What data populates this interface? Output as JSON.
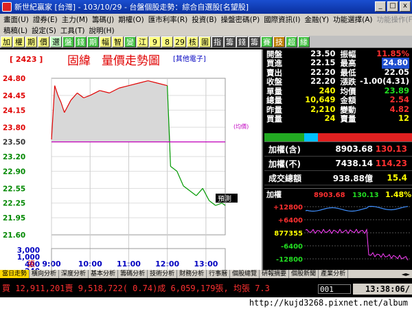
{
  "window": {
    "title": "新世紀贏家 [台灣] - 103/10/29 - 台盤個股走勢：綜合自選股[名望股]",
    "buttons": [
      "_",
      "□",
      "x"
    ]
  },
  "menu": {
    "row1": [
      "畫面(U)",
      "證券(E)",
      "主力(M)",
      "籌碼(J)",
      "期權(O)",
      "匯市利率(R)",
      "投資(B)",
      "操盤密碼(P)",
      "國際資訊(I)",
      "金融(Y)",
      "功能選擇(A)"
    ],
    "row1_disabled": [
      "功能操作(F)"
    ],
    "row2": [
      "稿稿(L)",
      "設定(S)",
      "工具(T)",
      "說明(H)"
    ]
  },
  "toolbar": [
    "加",
    "權",
    "期",
    "價",
    "選",
    "盤",
    "錢",
    "期",
    "幅",
    "智",
    "變",
    "江",
    "9",
    "8",
    "29",
    "核",
    "圍",
    "指",
    "籌",
    "錢",
    "籌",
    "賽",
    "技",
    "超",
    "緣"
  ],
  "chart": {
    "stock_code": "[ 2423 ]",
    "name": "固緯",
    "title": "量價走勢圖",
    "subtitle": "[其他電子]",
    "avg_label": "(均價)",
    "plan_label": "預測",
    "vol_unit": "張",
    "price_ticks": [
      "24.80",
      "24.45",
      "24.15",
      "23.80",
      "23.50",
      "23.20",
      "22.90",
      "22.55",
      "22.25",
      "21.95",
      "21.60"
    ],
    "vol_ticks": [
      "3,000",
      "1,000",
      "400",
      "240",
      "150",
      "90",
      "50",
      "30",
      "15"
    ],
    "time_ticks": [
      "9:00",
      "10:00",
      "11:00",
      "12:00",
      "13:00"
    ],
    "colors": {
      "up": "#e00000",
      "down": "#009900",
      "avg": "#c000c0",
      "volume": "#0000e0",
      "ref": "#e08000"
    }
  },
  "chart_data": {
    "type": "line",
    "x_labels": [
      "9:00",
      "10:00",
      "11:00",
      "12:00",
      "13:00"
    ],
    "price": [
      [
        "9:00",
        23.55
      ],
      [
        "9:05",
        24.65
      ],
      [
        "9:10",
        24.45
      ],
      [
        "9:15",
        24.3
      ],
      [
        "9:20",
        24.1
      ],
      [
        "9:30",
        24.35
      ],
      [
        "9:40",
        24.5
      ],
      [
        "9:50",
        24.4
      ],
      [
        "10:00",
        24.45
      ],
      [
        "10:15",
        24.55
      ],
      [
        "10:30",
        24.5
      ],
      [
        "10:45",
        24.6
      ],
      [
        "11:00",
        24.65
      ],
      [
        "11:15",
        24.7
      ],
      [
        "11:30",
        24.75
      ],
      [
        "11:45",
        24.7
      ],
      [
        "12:00",
        24.65
      ],
      [
        "12:05",
        23.0
      ],
      [
        "12:15",
        22.9
      ],
      [
        "12:25",
        22.6
      ],
      [
        "12:35",
        22.5
      ],
      [
        "12:45",
        22.4
      ],
      [
        "12:55",
        22.55
      ],
      [
        "13:05",
        22.3
      ],
      [
        "13:15",
        22.2
      ],
      [
        "13:25",
        22.25
      ],
      [
        "13:30",
        22.2
      ]
    ],
    "avg_price": 23.5,
    "reference_price": 23.5,
    "ylim": [
      21.6,
      24.8
    ]
  },
  "quote": {
    "rows": [
      {
        "l1": "開盤",
        "v1": "23.50",
        "c1": "white",
        "l2": "振幅",
        "v2": "11.85%",
        "c2": "red"
      },
      {
        "l1": "買進",
        "v1": "22.15",
        "c1": "white",
        "l2": "最高",
        "v2": "24.80",
        "c2": "hl"
      },
      {
        "l1": "賣出",
        "v1": "22.20",
        "c1": "white",
        "l2": "最低",
        "v2": "22.05",
        "c2": "white"
      },
      {
        "l1": "收盤",
        "v1": "22.20",
        "c1": "white",
        "l2": "漲跌",
        "v2": "-1.00(4.31)",
        "c2": "white"
      },
      {
        "l1": "單量",
        "v1": "240",
        "c1": "yellow",
        "l2": "均價",
        "v2": "23.89",
        "c2": "green"
      },
      {
        "l1": "總量",
        "v1": "10,649",
        "c1": "yellow",
        "l2": "金額",
        "v2": "2.54",
        "c2": "red"
      },
      {
        "l1": "昨量",
        "v1": "2,210",
        "c1": "yellow",
        "l2": "變動",
        "v2": "4.82",
        "c2": "red"
      },
      {
        "l1": "買量",
        "v1": "24",
        "c1": "yellow",
        "l2": "賣量",
        "v2": "12",
        "c2": "yellow"
      }
    ]
  },
  "index": {
    "rows": [
      {
        "label": "加權(含)",
        "value": "8903.68",
        "change": "130.13"
      },
      {
        "label": "加權(不)",
        "value": "7438.14",
        "change": "114.23"
      },
      {
        "label": "成交總額",
        "value": "938.88億",
        "change": "15.4"
      }
    ]
  },
  "mini": {
    "label": "加權",
    "value": "8903.68",
    "change": "130.13",
    "pct": "1.48%",
    "ticks": [
      "+12800",
      "+6400",
      "877355",
      "-6400",
      "-12800"
    ]
  },
  "tabs": [
    "當日走勢",
    "橫向分析",
    "深度分析",
    "基本分析",
    "籌碼分析",
    "技術分析",
    "財務分析",
    "行事曆",
    "個股總覽",
    "研報摘要",
    "個股新聞",
    "產業分析"
  ],
  "tab_scroll": "◄►",
  "status": {
    "ticker": "買 12,911,201賣 9,518,722( 0.74)成 6,059,179張, 均張 7.3",
    "page": "001",
    "clock": "13:38:06/",
    "watermark": "http://kujd3268.pixnet.net/album"
  }
}
